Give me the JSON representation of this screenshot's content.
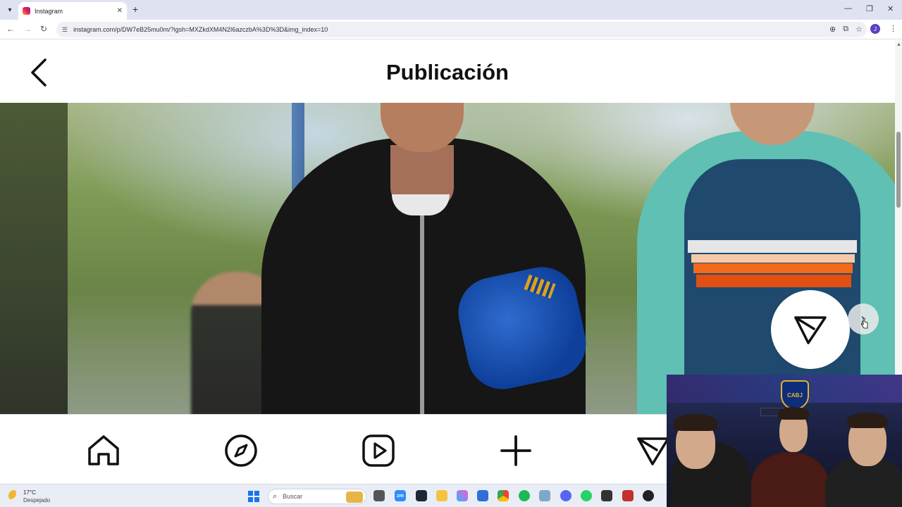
{
  "browser": {
    "tab_title": "Instagram",
    "url": "instagram.com/p/DW7eB25mu0m/?igsh=MXZkdXM4N2I6azczbA%3D%3D&img_index=10",
    "profile_initial": "J"
  },
  "page": {
    "title": "Publicación"
  },
  "bottom_nav": {
    "items": [
      "home-icon",
      "explore-icon",
      "reels-icon",
      "create-icon",
      "send-icon"
    ]
  },
  "overlay": {
    "webcam_badge": "CABJ"
  },
  "taskbar": {
    "weather_temp": "17°C",
    "weather_desc": "Despejado",
    "search_placeholder": "Buscar"
  },
  "colors": {
    "browser_chrome": "#dfe3f1",
    "instagram_black": "#111111",
    "taskbar": "#e9edf5"
  }
}
